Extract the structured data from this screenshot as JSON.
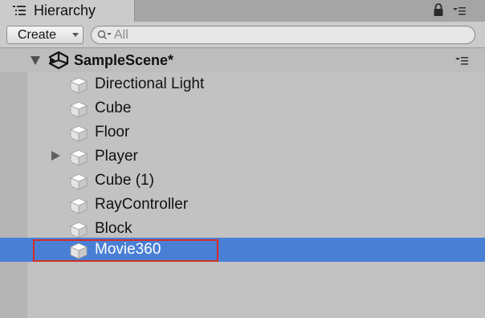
{
  "window": {
    "tab_label": "Hierarchy",
    "tab_icon": "hierarchy-list-icon",
    "lock_icon": "lock-icon",
    "menu_icon": "panel-menu-icon"
  },
  "toolbar": {
    "create_label": "Create",
    "search_placeholder": "All",
    "search_value": ""
  },
  "scene": {
    "name": "SampleScene*",
    "icon": "unity-logo-icon",
    "expanded": true
  },
  "hierarchy": {
    "items": [
      {
        "label": "Directional Light",
        "has_children": false,
        "selected": false
      },
      {
        "label": "Cube",
        "has_children": false,
        "selected": false
      },
      {
        "label": "Floor",
        "has_children": false,
        "selected": false
      },
      {
        "label": "Player",
        "has_children": true,
        "selected": false
      },
      {
        "label": "Cube (1)",
        "has_children": false,
        "selected": false
      },
      {
        "label": "RayController",
        "has_children": false,
        "selected": false
      },
      {
        "label": "Block",
        "has_children": false,
        "selected": false
      },
      {
        "label": "Movie360",
        "has_children": false,
        "selected": true
      }
    ]
  },
  "colors": {
    "selection": "#4a7fd6",
    "highlight_annotation": "#d12f27",
    "panel_background": "#c2c2c2"
  }
}
